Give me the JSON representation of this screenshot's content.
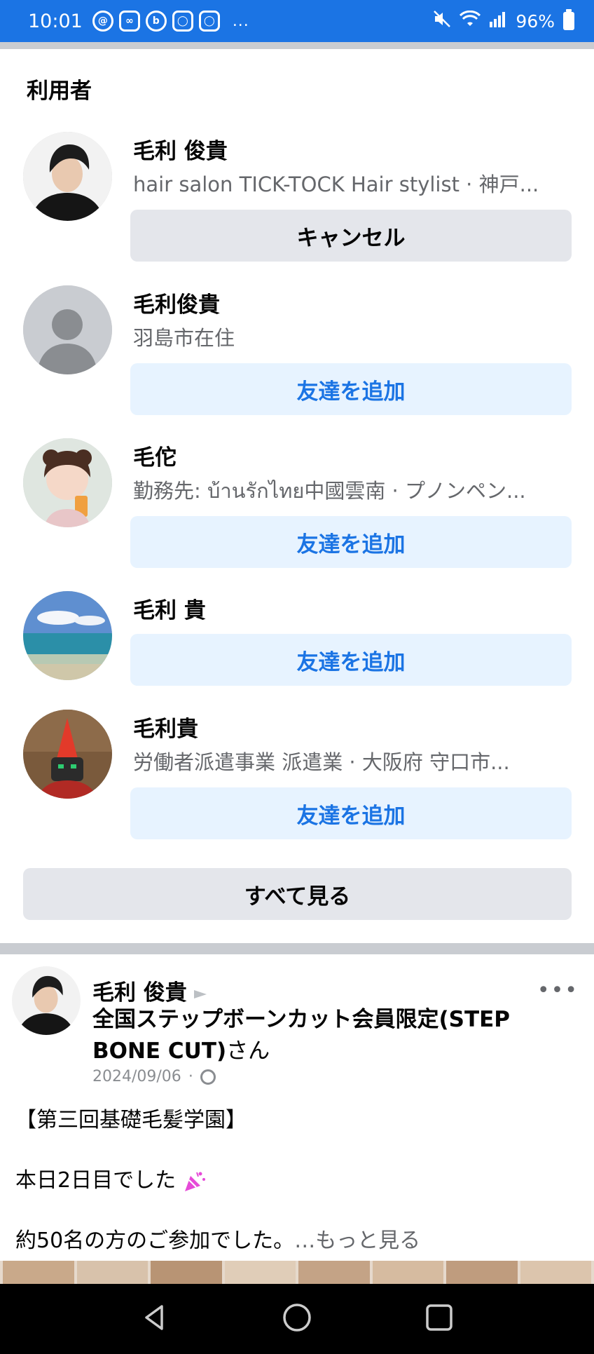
{
  "status_bar": {
    "time": "10:01",
    "battery": "96%",
    "app_icons": [
      "threads-icon",
      "link-icon",
      "b-icon",
      "instagram-icon",
      "instagram-icon"
    ],
    "more": "..."
  },
  "section": {
    "title": "利用者"
  },
  "users": [
    {
      "name": "毛利 俊貴",
      "subtitle": "hair salon TICK-TOCK Hair stylist · 神戸...",
      "button": "キャンセル"
    },
    {
      "name": "毛利俊貴",
      "subtitle": "羽島市在住",
      "button": "友達を追加"
    },
    {
      "name": "毛佗",
      "subtitle": "勤務先: บ้านรักไทย中國雲南 · プノンペン...",
      "button": "友達を追加"
    },
    {
      "name": "毛利 貴",
      "subtitle": "",
      "button": "友達を追加"
    },
    {
      "name": "毛利貴",
      "subtitle": "労働者派遣事業 派遣業 · 大阪府 守口市...",
      "button": "友達を追加"
    }
  ],
  "see_all_label": "すべて見る",
  "post": {
    "author": "毛利 俊貴",
    "group_name": "全国ステップボーンカット会員限定(STEP BONE CUT)",
    "group_suffix": "さん",
    "date": "2024/09/06",
    "separator": "·",
    "more_menu": "•••",
    "line1": "【第三回基礎毛髪学園】",
    "line2": "本日2日目でした",
    "line3": "約50名の方のご参加でした。",
    "see_more": "…もっと見る"
  }
}
